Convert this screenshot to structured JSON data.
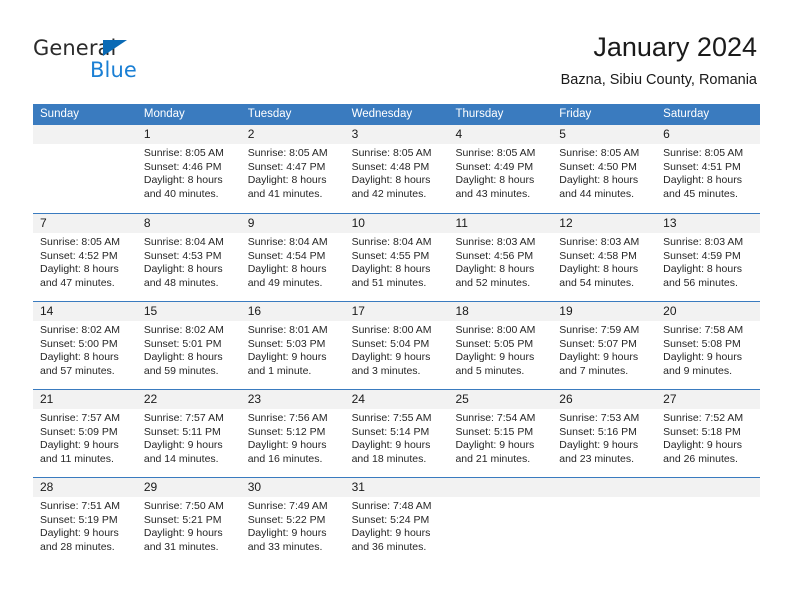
{
  "brand": {
    "name_part1": "General",
    "name_part2": "Blue",
    "triangle_color": "#0a6ab5",
    "blue_color": "#1a7fd4"
  },
  "header": {
    "title": "January 2024",
    "subtitle": "Bazna, Sibiu County, Romania"
  },
  "theme": {
    "header_blue": "#3a7bbf",
    "daynum_band": "#f2f2f2",
    "text": "#262626"
  },
  "weekdays": [
    "Sunday",
    "Monday",
    "Tuesday",
    "Wednesday",
    "Thursday",
    "Friday",
    "Saturday"
  ],
  "weeks": [
    [
      {
        "day": "",
        "lines": []
      },
      {
        "day": "1",
        "lines": [
          "Sunrise: 8:05 AM",
          "Sunset: 4:46 PM",
          "Daylight: 8 hours",
          "and 40 minutes."
        ]
      },
      {
        "day": "2",
        "lines": [
          "Sunrise: 8:05 AM",
          "Sunset: 4:47 PM",
          "Daylight: 8 hours",
          "and 41 minutes."
        ]
      },
      {
        "day": "3",
        "lines": [
          "Sunrise: 8:05 AM",
          "Sunset: 4:48 PM",
          "Daylight: 8 hours",
          "and 42 minutes."
        ]
      },
      {
        "day": "4",
        "lines": [
          "Sunrise: 8:05 AM",
          "Sunset: 4:49 PM",
          "Daylight: 8 hours",
          "and 43 minutes."
        ]
      },
      {
        "day": "5",
        "lines": [
          "Sunrise: 8:05 AM",
          "Sunset: 4:50 PM",
          "Daylight: 8 hours",
          "and 44 minutes."
        ]
      },
      {
        "day": "6",
        "lines": [
          "Sunrise: 8:05 AM",
          "Sunset: 4:51 PM",
          "Daylight: 8 hours",
          "and 45 minutes."
        ]
      }
    ],
    [
      {
        "day": "7",
        "lines": [
          "Sunrise: 8:05 AM",
          "Sunset: 4:52 PM",
          "Daylight: 8 hours",
          "and 47 minutes."
        ]
      },
      {
        "day": "8",
        "lines": [
          "Sunrise: 8:04 AM",
          "Sunset: 4:53 PM",
          "Daylight: 8 hours",
          "and 48 minutes."
        ]
      },
      {
        "day": "9",
        "lines": [
          "Sunrise: 8:04 AM",
          "Sunset: 4:54 PM",
          "Daylight: 8 hours",
          "and 49 minutes."
        ]
      },
      {
        "day": "10",
        "lines": [
          "Sunrise: 8:04 AM",
          "Sunset: 4:55 PM",
          "Daylight: 8 hours",
          "and 51 minutes."
        ]
      },
      {
        "day": "11",
        "lines": [
          "Sunrise: 8:03 AM",
          "Sunset: 4:56 PM",
          "Daylight: 8 hours",
          "and 52 minutes."
        ]
      },
      {
        "day": "12",
        "lines": [
          "Sunrise: 8:03 AM",
          "Sunset: 4:58 PM",
          "Daylight: 8 hours",
          "and 54 minutes."
        ]
      },
      {
        "day": "13",
        "lines": [
          "Sunrise: 8:03 AM",
          "Sunset: 4:59 PM",
          "Daylight: 8 hours",
          "and 56 minutes."
        ]
      }
    ],
    [
      {
        "day": "14",
        "lines": [
          "Sunrise: 8:02 AM",
          "Sunset: 5:00 PM",
          "Daylight: 8 hours",
          "and 57 minutes."
        ]
      },
      {
        "day": "15",
        "lines": [
          "Sunrise: 8:02 AM",
          "Sunset: 5:01 PM",
          "Daylight: 8 hours",
          "and 59 minutes."
        ]
      },
      {
        "day": "16",
        "lines": [
          "Sunrise: 8:01 AM",
          "Sunset: 5:03 PM",
          "Daylight: 9 hours",
          "and 1 minute."
        ]
      },
      {
        "day": "17",
        "lines": [
          "Sunrise: 8:00 AM",
          "Sunset: 5:04 PM",
          "Daylight: 9 hours",
          "and 3 minutes."
        ]
      },
      {
        "day": "18",
        "lines": [
          "Sunrise: 8:00 AM",
          "Sunset: 5:05 PM",
          "Daylight: 9 hours",
          "and 5 minutes."
        ]
      },
      {
        "day": "19",
        "lines": [
          "Sunrise: 7:59 AM",
          "Sunset: 5:07 PM",
          "Daylight: 9 hours",
          "and 7 minutes."
        ]
      },
      {
        "day": "20",
        "lines": [
          "Sunrise: 7:58 AM",
          "Sunset: 5:08 PM",
          "Daylight: 9 hours",
          "and 9 minutes."
        ]
      }
    ],
    [
      {
        "day": "21",
        "lines": [
          "Sunrise: 7:57 AM",
          "Sunset: 5:09 PM",
          "Daylight: 9 hours",
          "and 11 minutes."
        ]
      },
      {
        "day": "22",
        "lines": [
          "Sunrise: 7:57 AM",
          "Sunset: 5:11 PM",
          "Daylight: 9 hours",
          "and 14 minutes."
        ]
      },
      {
        "day": "23",
        "lines": [
          "Sunrise: 7:56 AM",
          "Sunset: 5:12 PM",
          "Daylight: 9 hours",
          "and 16 minutes."
        ]
      },
      {
        "day": "24",
        "lines": [
          "Sunrise: 7:55 AM",
          "Sunset: 5:14 PM",
          "Daylight: 9 hours",
          "and 18 minutes."
        ]
      },
      {
        "day": "25",
        "lines": [
          "Sunrise: 7:54 AM",
          "Sunset: 5:15 PM",
          "Daylight: 9 hours",
          "and 21 minutes."
        ]
      },
      {
        "day": "26",
        "lines": [
          "Sunrise: 7:53 AM",
          "Sunset: 5:16 PM",
          "Daylight: 9 hours",
          "and 23 minutes."
        ]
      },
      {
        "day": "27",
        "lines": [
          "Sunrise: 7:52 AM",
          "Sunset: 5:18 PM",
          "Daylight: 9 hours",
          "and 26 minutes."
        ]
      }
    ],
    [
      {
        "day": "28",
        "lines": [
          "Sunrise: 7:51 AM",
          "Sunset: 5:19 PM",
          "Daylight: 9 hours",
          "and 28 minutes."
        ]
      },
      {
        "day": "29",
        "lines": [
          "Sunrise: 7:50 AM",
          "Sunset: 5:21 PM",
          "Daylight: 9 hours",
          "and 31 minutes."
        ]
      },
      {
        "day": "30",
        "lines": [
          "Sunrise: 7:49 AM",
          "Sunset: 5:22 PM",
          "Daylight: 9 hours",
          "and 33 minutes."
        ]
      },
      {
        "day": "31",
        "lines": [
          "Sunrise: 7:48 AM",
          "Sunset: 5:24 PM",
          "Daylight: 9 hours",
          "and 36 minutes."
        ]
      },
      {
        "day": "",
        "lines": []
      },
      {
        "day": "",
        "lines": []
      },
      {
        "day": "",
        "lines": []
      }
    ]
  ]
}
